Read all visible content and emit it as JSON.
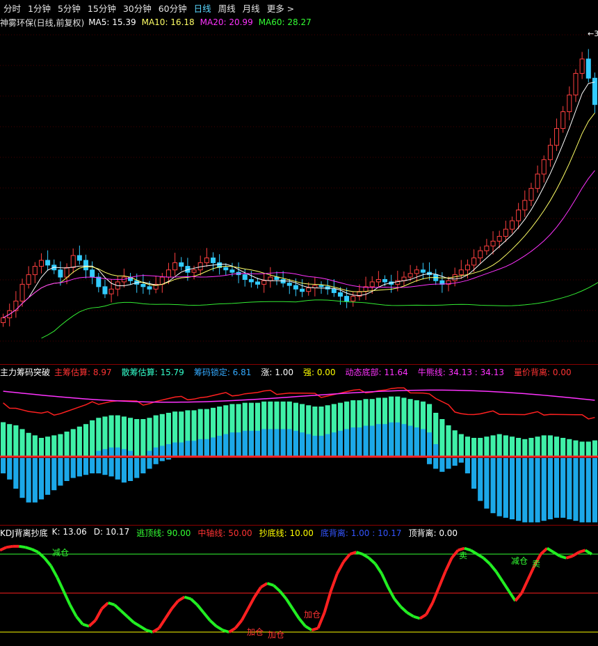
{
  "tabs": [
    "分时",
    "1分钟",
    "5分钟",
    "15分钟",
    "30分钟",
    "60分钟",
    "日线",
    "周线",
    "月线",
    "更多 >"
  ],
  "active_tab": "日线",
  "panel1": {
    "title": "神雾环保(日线,前复权)",
    "ma": [
      {
        "label": "MA5: 15.39",
        "color": "#ffffff"
      },
      {
        "label": "MA10: 16.18",
        "color": "#ffff66"
      },
      {
        "label": "MA20: 20.99",
        "color": "#ff33ff"
      },
      {
        "label": "MA60: 28.27",
        "color": "#33ff33"
      }
    ],
    "max_marker": "3"
  },
  "panel2": {
    "title": "主力筹码突破",
    "items": [
      {
        "label": "主筹估算: 8.97",
        "color": "#ff3333"
      },
      {
        "label": "散筹估算: 15.79",
        "color": "#33ffcc"
      },
      {
        "label": "筹码锁定: 6.81",
        "color": "#33aaff"
      },
      {
        "label": "涨: 1.00",
        "color": "#ffffff"
      },
      {
        "label": "强: 0.00",
        "color": "#ffff00"
      },
      {
        "label": "动态底部: 11.64",
        "color": "#ff33ff"
      },
      {
        "label": "牛熊线: 34.13 : 34.13",
        "color": "#ff33ff"
      },
      {
        "label": "量价背离: 0.00",
        "color": "#ff3333"
      }
    ]
  },
  "panel3": {
    "title": "KDJ背离抄底",
    "items": [
      {
        "label": "K: 13.06",
        "color": "#ffffff"
      },
      {
        "label": "D: 10.17",
        "color": "#ffffff"
      },
      {
        "label": "逃顶线: 90.00",
        "color": "#33ff33"
      },
      {
        "label": "中轴线: 50.00",
        "color": "#ff3333"
      },
      {
        "label": "抄底线: 10.00",
        "color": "#ffff00"
      },
      {
        "label": "底背离: 1.00 : 10.17",
        "color": "#3355ff"
      },
      {
        "label": "顶背离: 0.00",
        "color": "#ffffff"
      }
    ],
    "annotations": [
      "减仓",
      "卖",
      "加仓",
      "加仓",
      "加仓",
      "减仓",
      "卖"
    ]
  },
  "chart_data": [
    {
      "type": "candlestick",
      "title": "神雾环保(日线,前复权)",
      "close": [
        15.8,
        16.4,
        17.2,
        18.6,
        19.4,
        20.1,
        20.6,
        20.2,
        19.8,
        19.2,
        20.0,
        21.0,
        20.6,
        19.8,
        19.2,
        18.4,
        17.8,
        18.2,
        18.8,
        19.2,
        18.9,
        18.6,
        18.4,
        18.2,
        18.6,
        19.2,
        19.8,
        20.4,
        20.1,
        19.6,
        19.8,
        20.4,
        20.8,
        20.4,
        20.0,
        19.8,
        19.6,
        19.4,
        19.0,
        18.8,
        18.6,
        18.9,
        19.2,
        19.0,
        18.7,
        18.5,
        18.2,
        18.0,
        18.3,
        18.5,
        18.4,
        18.2,
        17.9,
        17.6,
        17.2,
        17.6,
        18.0,
        18.4,
        18.8,
        19.0,
        18.8,
        18.6,
        18.9,
        19.2,
        19.5,
        19.8,
        19.6,
        19.4,
        18.9,
        18.6,
        18.9,
        19.4,
        19.8,
        20.2,
        20.8,
        21.4,
        21.8,
        22.2,
        22.6,
        23.2,
        23.9,
        24.8,
        25.6,
        26.6,
        27.8,
        29.0,
        30.2,
        31.6,
        33.0,
        34.4,
        36.2,
        37.4,
        35.8,
        33.6
      ],
      "ma_values": {
        "MA5": 15.39,
        "MA10": 16.18,
        "MA20": 20.99,
        "MA60": 28.27
      },
      "series": [
        {
          "name": "MA5"
        },
        {
          "name": "MA10"
        },
        {
          "name": "MA20"
        },
        {
          "name": "MA60"
        }
      ]
    },
    {
      "type": "bar",
      "title": "主力筹码突破",
      "upper_bars": [
        55,
        52,
        50,
        44,
        38,
        34,
        30,
        32,
        34,
        36,
        40,
        44,
        48,
        52,
        58,
        62,
        64,
        66,
        66,
        64,
        62,
        60,
        60,
        62,
        66,
        68,
        70,
        72,
        72,
        74,
        74,
        76,
        76,
        78,
        80,
        82,
        84,
        84,
        86,
        86,
        86,
        88,
        88,
        88,
        88,
        88,
        86,
        84,
        82,
        80,
        80,
        82,
        84,
        86,
        88,
        90,
        90,
        92,
        92,
        94,
        94,
        96,
        96,
        94,
        92,
        90,
        88,
        84,
        70,
        60,
        50,
        42,
        36,
        32,
        30,
        30,
        32,
        34,
        36,
        34,
        32,
        30,
        28,
        30,
        32,
        34,
        34,
        32,
        30,
        28,
        26,
        24,
        24,
        26
      ],
      "lower_bars": [
        20,
        28,
        40,
        52,
        58,
        58,
        54,
        48,
        42,
        36,
        30,
        26,
        24,
        22,
        20,
        20,
        22,
        24,
        28,
        32,
        30,
        26,
        20,
        14,
        8,
        4,
        2,
        0,
        0,
        0,
        0,
        0,
        0,
        0,
        0,
        0,
        0,
        0,
        0,
        0,
        0,
        0,
        0,
        0,
        0,
        0,
        0,
        0,
        0,
        0,
        0,
        0,
        0,
        0,
        0,
        0,
        0,
        0,
        0,
        0,
        0,
        0,
        0,
        0,
        0,
        0,
        0,
        8,
        14,
        18,
        14,
        10,
        6,
        20,
        40,
        56,
        66,
        72,
        76,
        78,
        80,
        82,
        84,
        84,
        84,
        82,
        80,
        78,
        78,
        80,
        82,
        84,
        84,
        84
      ]
    },
    {
      "type": "line",
      "title": "KDJ背离抄底",
      "hlines": {
        "逃顶线": 90,
        "中轴线": 50,
        "抄底线": 10
      },
      "ylim": [
        0,
        100
      ],
      "k": [
        94,
        97,
        98,
        98,
        97,
        95,
        92,
        86,
        78,
        66,
        52,
        38,
        26,
        18,
        16,
        22,
        34,
        40,
        38,
        32,
        26,
        20,
        16,
        12,
        10,
        14,
        24,
        34,
        42,
        46,
        44,
        38,
        30,
        22,
        16,
        12,
        10,
        14,
        22,
        34,
        46,
        56,
        60,
        58,
        52,
        44,
        34,
        24,
        16,
        12,
        14,
        30,
        52,
        70,
        82,
        90,
        92,
        90,
        86,
        80,
        70,
        56,
        44,
        36,
        30,
        26,
        24,
        28,
        40,
        56,
        72,
        86,
        94,
        96,
        94,
        90,
        86,
        80,
        72,
        62,
        52,
        42,
        50,
        64,
        78,
        90,
        96,
        92,
        88,
        86,
        88,
        92,
        94,
        90
      ]
    }
  ]
}
